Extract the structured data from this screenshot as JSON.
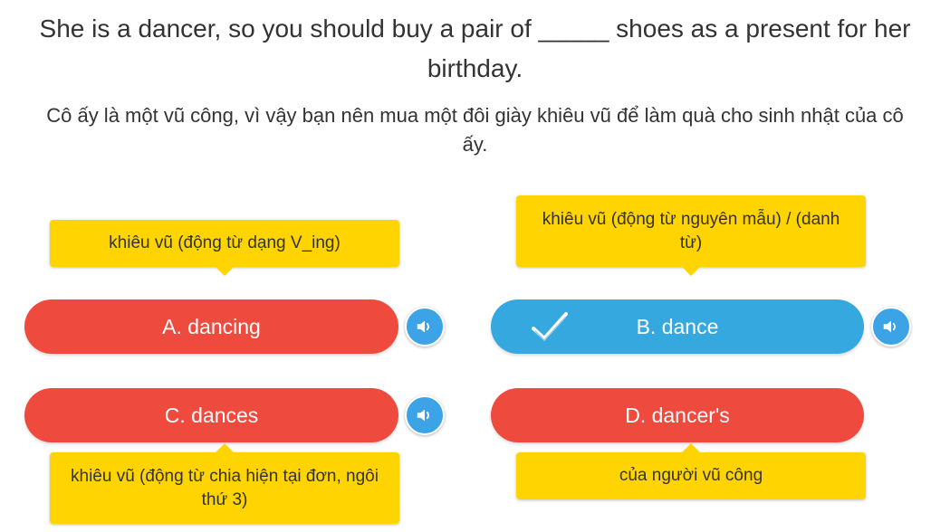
{
  "question": {
    "text": "She is a dancer, so you should buy a pair of _____ shoes as a present for her birthday.",
    "translation": "Cô ấy là một vũ công, vì vậy bạn nên mua một đôi giày khiêu vũ để làm quà cho sinh nhật của cô ấy."
  },
  "options": [
    {
      "id": "A",
      "label": "A. dancing",
      "hint": "khiêu vũ (động từ dạng V_ing)",
      "status": "wrong",
      "speaker_icon": "speaker-icon"
    },
    {
      "id": "B",
      "label": "B. dance",
      "hint": "khiêu vũ (động từ nguyên mẫu) / (danh từ)",
      "status": "correct",
      "check_icon": "check-icon",
      "speaker_icon": "speaker-icon"
    },
    {
      "id": "C",
      "label": "C. dances",
      "hint": "khiêu vũ (động từ chia hiện tại đơn, ngôi thứ 3)",
      "status": "wrong",
      "speaker_icon": "speaker-icon"
    },
    {
      "id": "D",
      "label": "D. dancer's",
      "hint": "của người vũ công",
      "status": "wrong"
    }
  ],
  "colors": {
    "wrong": "#EE4A3E",
    "correct": "#36A8E0",
    "hint": "#FFD400",
    "speaker": "#3BA3E6",
    "text": "#333333"
  }
}
